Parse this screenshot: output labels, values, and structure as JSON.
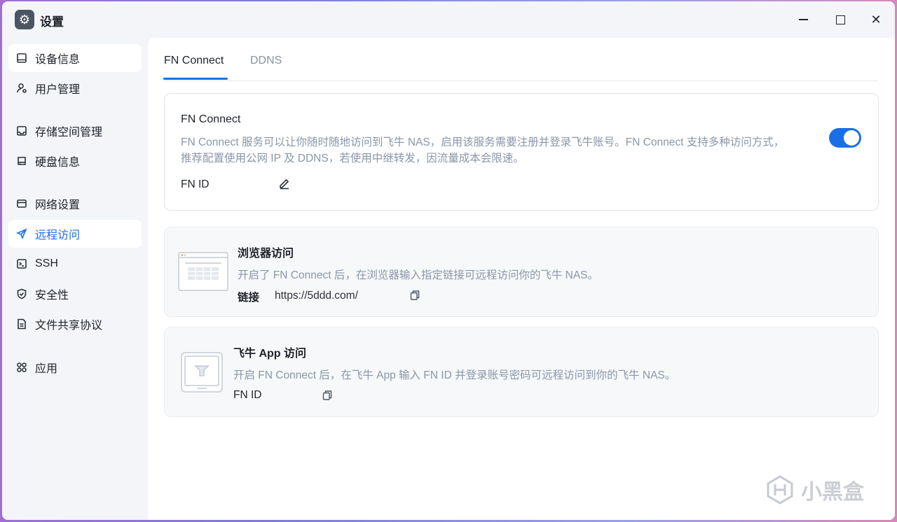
{
  "window": {
    "title": "设置",
    "app_icon": "gear-icon"
  },
  "sidebar": {
    "items": [
      {
        "label": "设备信息",
        "icon": "device-icon"
      },
      {
        "label": "用户管理",
        "icon": "user-gear-icon"
      },
      {
        "label": "存储空间管理",
        "icon": "storage-icon"
      },
      {
        "label": "硬盘信息",
        "icon": "disk-icon"
      },
      {
        "label": "网络设置",
        "icon": "network-icon"
      },
      {
        "label": "远程访问",
        "icon": "send-icon"
      },
      {
        "label": "SSH",
        "icon": "terminal-icon"
      },
      {
        "label": "安全性",
        "icon": "shield-icon"
      },
      {
        "label": "文件共享协议",
        "icon": "file-icon"
      },
      {
        "label": "应用",
        "icon": "apps-icon"
      }
    ],
    "selected_label": "远程访问"
  },
  "tabs": [
    {
      "label": "FN Connect"
    },
    {
      "label": "DDNS"
    }
  ],
  "fn_connect": {
    "title": "FN Connect",
    "desc_line1": "FN Connect 服务可以让你随时随地访问到飞牛 NAS，启用该服务需要注册并登录飞牛账号。FN Connect 支持多种访问方式，",
    "desc_line2": "推荐配置使用公网 IP 及 DDNS，若使用中继转发，因流量成本会限速。",
    "fn_id_label": "FN ID",
    "enabled": true
  },
  "browser_access": {
    "title": "浏览器访问",
    "desc": "开启了 FN Connect 后，在浏览器输入指定链接可远程访问你的飞牛 NAS。",
    "link_label": "链接",
    "link_value": "https://5ddd.com/"
  },
  "app_access": {
    "title": "飞牛 App 访问",
    "desc": "开启 FN Connect 后，在飞牛 App 输入 FN ID 并登录账号密码可远程访问到你的飞牛 NAS。",
    "fn_id_label": "FN ID"
  },
  "watermark": {
    "text": "小黑盒"
  },
  "colors": {
    "accent": "#1a6fe8",
    "desc_text": "#8a96a8"
  }
}
